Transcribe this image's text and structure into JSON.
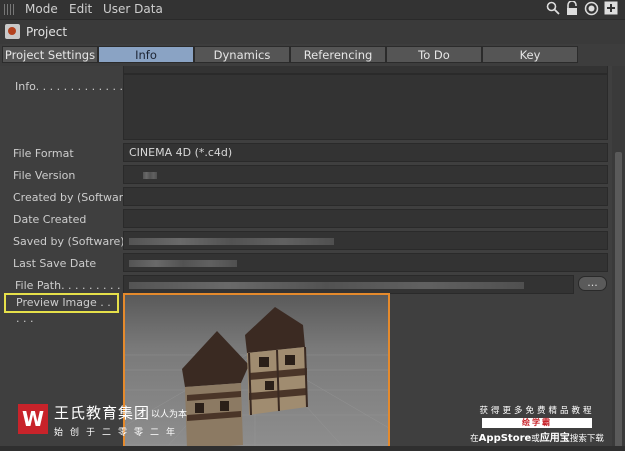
{
  "menubar": {
    "items": [
      "Mode",
      "Edit",
      "User Data"
    ]
  },
  "toolbar": {
    "icons": [
      "search-icon",
      "lock-icon",
      "target-icon",
      "plus-box-icon"
    ]
  },
  "window": {
    "title": "Project"
  },
  "tabs": [
    {
      "label": "Project Settings",
      "active": false
    },
    {
      "label": "Info",
      "active": true
    },
    {
      "label": "Dynamics",
      "active": false
    },
    {
      "label": "Referencing",
      "active": false
    },
    {
      "label": "To Do",
      "active": false
    },
    {
      "label": "Key Interpolation",
      "active": false
    }
  ],
  "info": {
    "label": "Info. . . . . . . . . . . . . . ."
  },
  "fields": {
    "file_format": {
      "label": "File Format",
      "value": "CINEMA 4D (*.c4d)"
    },
    "file_version": {
      "label": "File Version"
    },
    "created_by": {
      "label": "Created by (Software)"
    },
    "date_created": {
      "label": "Date Created"
    },
    "saved_by": {
      "label": "Saved by (Software)"
    },
    "last_save_date": {
      "label": "Last Save Date"
    },
    "file_path": {
      "label": "File Path. . . . . . . . .",
      "button": "..."
    }
  },
  "preview": {
    "label": "Preview Image . . . . ."
  },
  "watermark": {
    "logo": "W",
    "brand": "王氏教育集团",
    "slogan": "以人为本",
    "since": "始创于二零零二年"
  },
  "ad": {
    "line1": "获得更多免费精品教程",
    "line2": "绘学霸",
    "line3_prefix": "在",
    "line3_store": "AppStore",
    "line3_mid": "或",
    "line3_app": "应用宝",
    "line3_suffix": "搜索下载"
  },
  "colors": {
    "active_tab": "#8aa3c4",
    "preview_highlight": "#e58a2c",
    "label_highlight": "#e6e04a",
    "brand_red": "#c8232a"
  }
}
